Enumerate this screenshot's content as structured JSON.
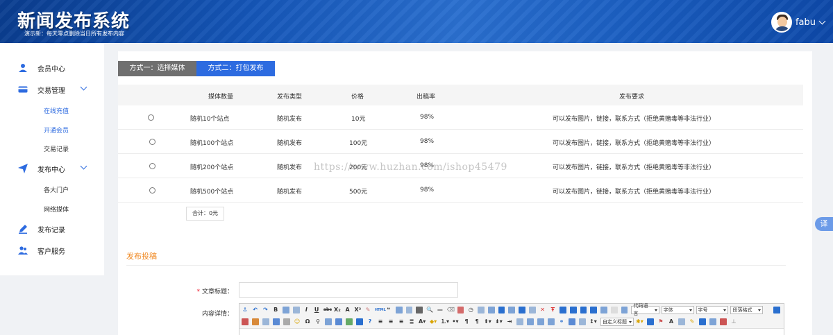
{
  "header": {
    "title": "新闻发布系统",
    "subtitle": "演示新：每天零点删除当日所有发布内容",
    "username": "fabu"
  },
  "sidebar": {
    "items": [
      {
        "label": "会员中心",
        "icon": "user-icon"
      },
      {
        "label": "交易管理",
        "icon": "card-icon",
        "expanded": true,
        "children": [
          {
            "label": "在线充值",
            "active": true
          },
          {
            "label": "开通会员",
            "active": true
          },
          {
            "label": "交易记录",
            "active": false
          }
        ]
      },
      {
        "label": "发布中心",
        "icon": "send-icon",
        "expanded": true,
        "children": [
          {
            "label": "各大门户"
          },
          {
            "label": "网络媒体"
          }
        ]
      },
      {
        "label": "发布记录",
        "icon": "pen-icon"
      },
      {
        "label": "客户服务",
        "icon": "customers-icon"
      }
    ]
  },
  "tabs": [
    {
      "label": "方式一：选择媒体",
      "active": false
    },
    {
      "label": "方式二：打包发布",
      "active": true
    }
  ],
  "table": {
    "headers": [
      "媒体数量",
      "发布类型",
      "价格",
      "出稿率",
      "发布要求"
    ],
    "rows": [
      {
        "count": "随机10个站点",
        "type": "随机发布",
        "price": "10元",
        "rate": "98%",
        "req": "可以发布图片，链接，联系方式（拒绝黄赌毒等非法行业）"
      },
      {
        "count": "随机100个站点",
        "type": "随机发布",
        "price": "100元",
        "rate": "98%",
        "req": "可以发布图片，链接，联系方式（拒绝黄赌毒等非法行业）"
      },
      {
        "count": "随机200个站点",
        "type": "随机发布",
        "price": "200元",
        "rate": "98%",
        "req": "可以发布图片，链接，联系方式（拒绝黄赌毒等非法行业）"
      },
      {
        "count": "随机500个站点",
        "type": "随机发布",
        "price": "500元",
        "rate": "98%",
        "req": "可以发布图片，链接，联系方式（拒绝黄赌毒等非法行业）"
      }
    ]
  },
  "total_label": "合计：0元",
  "section_title": "发布投稿",
  "form": {
    "title_label": "文章标题：",
    "title_required_mark": "*",
    "title_value": "",
    "content_label": "内容详情："
  },
  "editor": {
    "selects": {
      "code_language": "代码语言",
      "font": "字体",
      "font_size": "字号",
      "paragraph": "段落格式",
      "custom_title": "自定义标题"
    }
  },
  "translate_label": "译",
  "watermark": "https://www.huzhan.com/ishop45479",
  "colors": {
    "accent": "#2d6be0",
    "tab_inactive": "#6f6f6f",
    "section_title": "#f08a24",
    "header": "#1556b8"
  }
}
